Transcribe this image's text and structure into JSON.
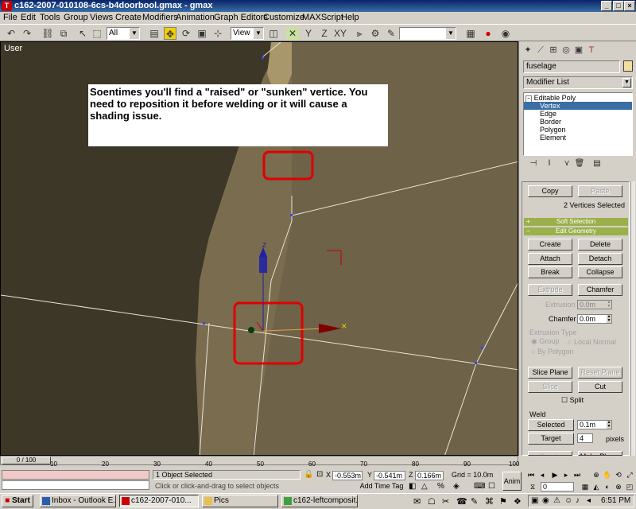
{
  "window": {
    "title": "c162-2007-010108-6cs-b4doorbool.gmax - gmax",
    "app_icon": "gmax-icon"
  },
  "menu": [
    "File",
    "Edit",
    "Tools",
    "Group",
    "Views",
    "Create",
    "Modifiers",
    "Animation",
    "Graph Editors",
    "Customize",
    "MAXScript",
    "Help"
  ],
  "toolbar": {
    "selection_filter": "All",
    "ref_coord": "View"
  },
  "viewport": {
    "label": "User",
    "note_text": "Soentimes you'll find a \"raised\" or \"sunken\" vertice. You need to reposition it before welding or it will cause a shading issue.",
    "gizmo_label": "Z"
  },
  "command_panel": {
    "object_name": "fuselage",
    "modifier_list": "Modifier List",
    "stack": {
      "root": "Editable Poly",
      "items": [
        "Vertex",
        "Edge",
        "Border",
        "Polygon",
        "Element"
      ],
      "selected_index": 0
    },
    "copy": "Copy",
    "paste": "Paste",
    "selection_info": "2 Vertices Selected",
    "soft_selection": "Soft Selection",
    "edit_geometry": "Edit Geometry",
    "buttons": {
      "create": "Create",
      "delete": "Delete",
      "attach": "Attach",
      "detach": "Detach",
      "break": "Break",
      "collapse": "Collapse",
      "extrude": "Extrude",
      "chamfer": "Chamfer",
      "slice_plane": "Slice Plane",
      "reset_plane": "Reset Plane",
      "slice": "Slice",
      "cut": "Cut",
      "weld_selected": "Selected",
      "weld_target": "Target",
      "create_shape": "Create Shape",
      "make_planar": "Make Planar"
    },
    "extrusion_label": "Extrusion",
    "extrusion_value": "0.0m",
    "chamfer_label": "Chamfer",
    "chamfer_value": "0.0m",
    "extrusion_type": "Extrusion Type",
    "opt_group": "Group",
    "opt_local_normal": "Local Normal",
    "opt_by_polygon": "By Polygon",
    "split": "Split",
    "weld": "Weld",
    "weld_selected_value": "0.1m",
    "weld_target_value": "4",
    "pixels": "pixels"
  },
  "timeline": {
    "frame_readout": "0 / 100",
    "ticks": [
      "10",
      "20",
      "30",
      "40",
      "50",
      "60",
      "70",
      "80",
      "90",
      "100"
    ]
  },
  "status": {
    "object_selected": "1 Object Selected",
    "prompt": "Click or click-and-drag to select objects",
    "add_time_tag": "Add Time Tag",
    "x_label": "X",
    "x_value": "-0.553m",
    "y_label": "Y",
    "y_value": "-0.541m",
    "z_label": "Z",
    "z_value": "0.166m",
    "grid": "Grid = 10.0m",
    "anim": "Anim",
    "frame_field": "0"
  },
  "taskbar": {
    "start": "Start",
    "tasks": [
      "Inbox - Outlook E...",
      "c162-2007-010...",
      "Pics",
      "c162-leftcomposit..."
    ],
    "active_index": 1,
    "clock": "6:51 PM"
  },
  "colors": {
    "viewport_bg": "#6e6248",
    "dark_fuselage": "#3d3728",
    "highlight_red": "#e00000",
    "rollout_green": "#9ab04a",
    "stack_selected": "#3a6ea5"
  }
}
